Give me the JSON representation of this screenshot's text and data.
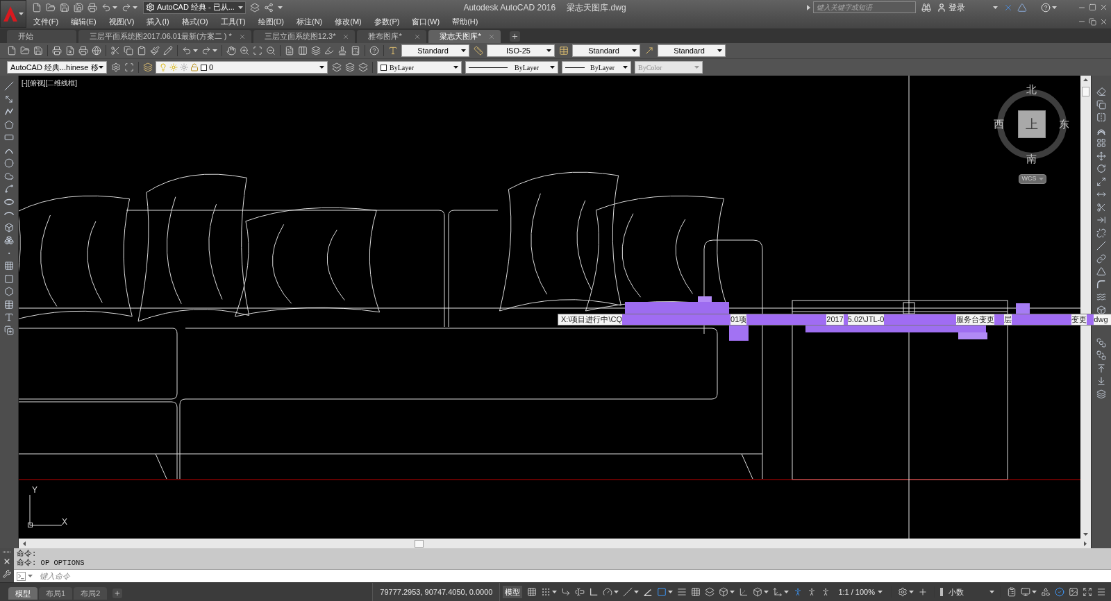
{
  "title_bar": {
    "workspace": "AutoCAD 经典 - 已从...",
    "app_title": "Autodesk AutoCAD 2016",
    "file_name": "梁志天图库.dwg",
    "search": {
      "placeholder": "键入关键字或短语"
    },
    "sign_in": "登录"
  },
  "menu_bar": [
    "文件(F)",
    "编辑(E)",
    "视图(V)",
    "插入(I)",
    "格式(O)",
    "工具(T)",
    "绘图(D)",
    "标注(N)",
    "修改(M)",
    "参数(P)",
    "窗口(W)",
    "帮助(H)"
  ],
  "file_tabs": [
    {
      "label": "开始",
      "selected": false,
      "closable": false
    },
    {
      "label": "三层平面系统图2017.06.01最新(方案二 ) *",
      "selected": false,
      "closable": true
    },
    {
      "label": "三层立面系统图12.3*",
      "selected": false,
      "closable": true
    },
    {
      "label": "雅布图库*",
      "selected": false,
      "closable": true
    },
    {
      "label": "梁志天图库*",
      "selected": true,
      "closable": true
    }
  ],
  "styles_toolbar": [
    {
      "kind": "text",
      "value": "Standard"
    },
    {
      "kind": "dimension",
      "value": "ISO-25"
    },
    {
      "kind": "table",
      "value": "Standard"
    },
    {
      "kind": "multileader",
      "value": "Standard"
    }
  ],
  "layers_toolbar": {
    "workspace": "AutoCAD 经典...hinese 移",
    "layer": "0"
  },
  "properties_toolbar": [
    {
      "kind": "color",
      "value": "ByLayer",
      "disabled": false
    },
    {
      "kind": "linetype",
      "value": "ByLayer",
      "disabled": false
    },
    {
      "kind": "lineweight",
      "value": "ByLayer",
      "disabled": false
    },
    {
      "kind": "plot_style",
      "value": "ByColor",
      "disabled": true
    }
  ],
  "viewport": {
    "label": "[-][俯视][二维线框]",
    "viewcube": {
      "north": "北",
      "south": "南",
      "east": "东",
      "west": "西",
      "face": "上",
      "coordinate_system": "WCS"
    },
    "ucs_icon": {
      "y": "Y",
      "x": "X"
    }
  },
  "tooltip": {
    "fragments": [
      "X:\\项目进行中\\CQ",
      "01项",
      "2017",
      "5.02\\JTL-0",
      "服务台变更",
      "层",
      "变更",
      "dwg"
    ]
  },
  "command_line": {
    "history": [
      "命令:",
      "命令: OP OPTIONS"
    ],
    "input": {
      "placeholder": "键入命令"
    }
  },
  "status_bar": {
    "layout_tabs": [
      {
        "label": "模型",
        "selected": true
      },
      {
        "label": "布局1",
        "selected": false
      },
      {
        "label": "布局2",
        "selected": false
      }
    ],
    "coordinates": "79777.2953, 90747.4050, 0.0000",
    "space": "模型",
    "left_toggles": [
      {
        "on": false
      },
      {
        "on": false
      },
      {
        "on": false
      },
      {
        "on": false
      },
      {
        "on": false
      },
      {
        "on": false
      },
      {
        "on": false
      },
      {
        "on": false
      },
      {
        "on": true
      },
      {
        "on": false
      },
      {
        "on": false
      },
      {
        "on": false
      },
      {
        "on": false
      },
      {
        "on": false
      },
      {
        "on": false
      },
      {
        "on": false
      },
      {
        "on": true
      },
      {
        "on": false
      },
      {
        "on": false
      }
    ],
    "annotation_scale": "1:1 / 100%",
    "middle_toggles": [
      {
        "on": false
      },
      {
        "on": false
      }
    ],
    "units": "小数",
    "right_toggles": [
      {
        "on": false
      },
      {
        "on": false
      },
      {
        "on": false
      },
      {
        "on": true
      },
      {
        "on": false
      },
      {
        "on": false
      },
      {
        "on": false
      }
    ]
  }
}
